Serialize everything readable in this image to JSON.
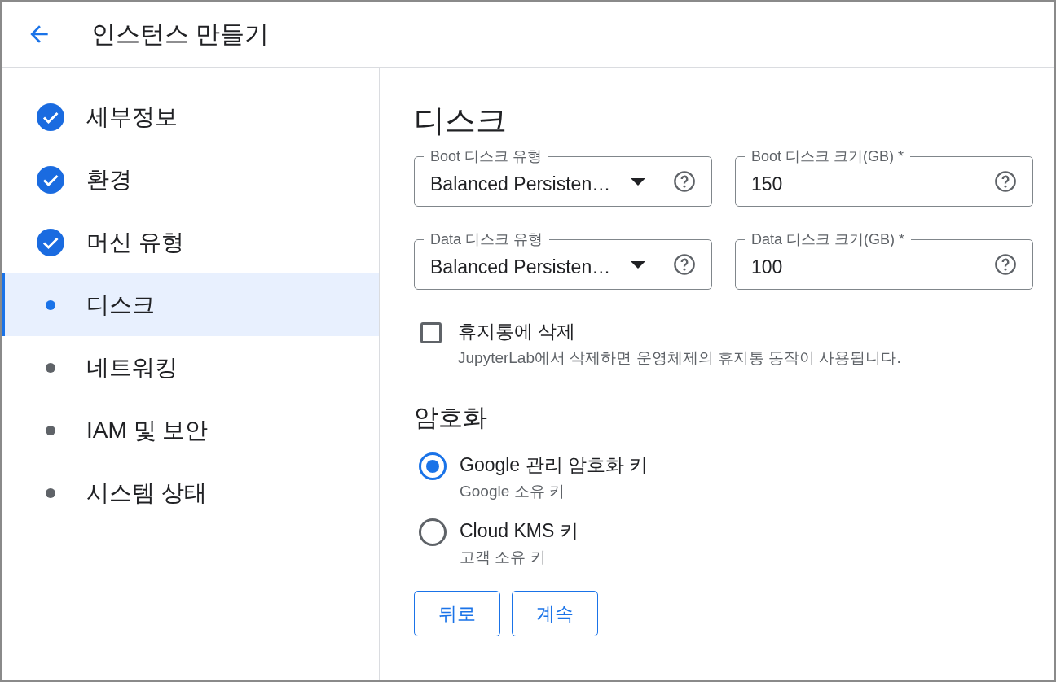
{
  "header": {
    "title": "인스턴스 만들기"
  },
  "steps": [
    {
      "label": "세부정보",
      "completed": true,
      "selected": false
    },
    {
      "label": "환경",
      "completed": true,
      "selected": false
    },
    {
      "label": "머신 유형",
      "completed": true,
      "selected": false
    },
    {
      "label": "디스크",
      "completed": false,
      "selected": true
    },
    {
      "label": "네트워킹",
      "completed": false,
      "selected": false
    },
    {
      "label": "IAM 및 보안",
      "completed": false,
      "selected": false
    },
    {
      "label": "시스템 상태",
      "completed": false,
      "selected": false
    }
  ],
  "section_title": "디스크",
  "fields": [
    {
      "kind": "select",
      "label": "Boot 디스크 유형",
      "value": "Balanced Persisten…"
    },
    {
      "kind": "text",
      "label": "Boot 디스크 크기(GB) *",
      "value": "150"
    },
    {
      "kind": "select",
      "label": "Data 디스크 유형",
      "value": "Balanced Persisten…"
    },
    {
      "kind": "text",
      "label": "Data 디스크 크기(GB) *",
      "value": "100"
    }
  ],
  "trash_option": {
    "label": "휴지통에 삭제",
    "checked": false,
    "description": "JupyterLab에서 삭제하면 운영체제의 휴지통 동작이 사용됩니다."
  },
  "encryption": {
    "title": "암호화",
    "options": [
      {
        "label": "Google 관리 암호화 키",
        "description": "Google 소유 키",
        "selected": true
      },
      {
        "label": "Cloud KMS 키",
        "description": "고객 소유 키",
        "selected": false
      }
    ]
  },
  "buttons": [
    "뒤로",
    "계속"
  ]
}
